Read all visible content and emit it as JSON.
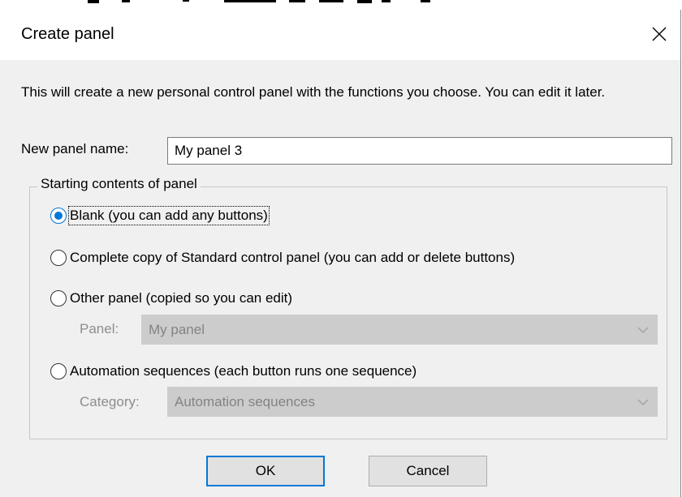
{
  "dialog": {
    "title": "Create panel",
    "description": "This will create a new personal control panel with the functions you choose. You can edit it later.",
    "name_label": "New panel name:",
    "name_value": "My panel 3",
    "group_title": "Starting contents of panel",
    "options": [
      {
        "label": "Blank (you can add any buttons)",
        "checked": true
      },
      {
        "label": "Complete copy of Standard control panel (you can add or delete buttons)",
        "checked": false
      },
      {
        "label": "Other panel (copied so you can edit)",
        "checked": false
      },
      {
        "label": "Automation sequences (each button runs one sequence)",
        "checked": false
      }
    ],
    "panel_label": "Panel:",
    "panel_value": "My panel",
    "category_label": "Category:",
    "category_value": "Automation sequences",
    "ok_label": "OK",
    "cancel_label": "Cancel"
  },
  "icons": {
    "close": "close-icon",
    "dropdown": "chevron-down-icon"
  },
  "colors": {
    "accent": "#0078d7",
    "dialog_bg": "#f0f0f0",
    "disabled_field": "#cccccc",
    "disabled_text": "#8d8d8d"
  }
}
